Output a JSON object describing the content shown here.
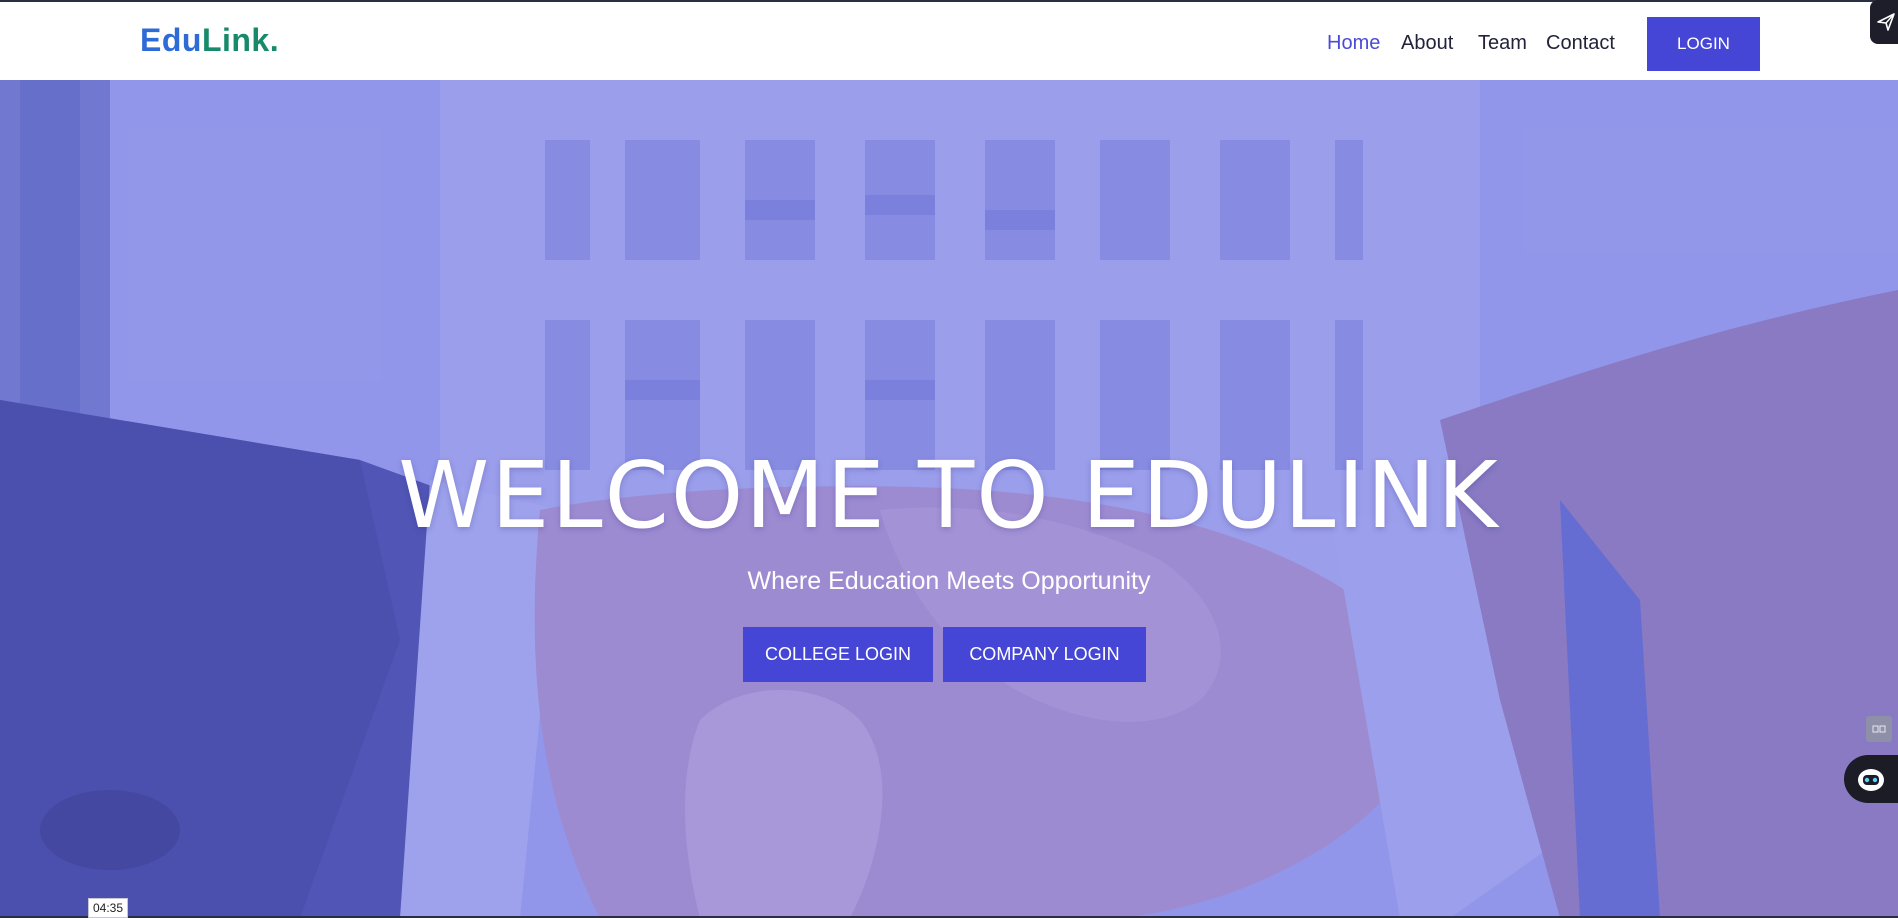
{
  "brand": {
    "part1": "Edu",
    "part2": "Link",
    "dot": "."
  },
  "nav": {
    "items": [
      {
        "label": "Home",
        "active": true
      },
      {
        "label": "About",
        "active": false
      },
      {
        "label": "Team",
        "active": false
      },
      {
        "label": "Contact",
        "active": false
      }
    ],
    "login_label": "LOGIN"
  },
  "hero": {
    "title": "WELCOME TO EDULINK",
    "subtitle": "Where Education Meets Opportunity",
    "buttons": {
      "college": "COLLEGE LOGIN",
      "company": "COMPANY LOGIN"
    }
  },
  "overlay": {
    "timestamp": "04:35"
  },
  "colors": {
    "accent": "#4646d6",
    "brand_blue": "#2e6bd6",
    "brand_green": "#168a6b",
    "nav_active": "#4a4bd6",
    "overlay_tint": "#5a5fe1"
  },
  "icons": {
    "send": "send-icon",
    "bot": "bot-icon",
    "mini": "expand-icon"
  }
}
